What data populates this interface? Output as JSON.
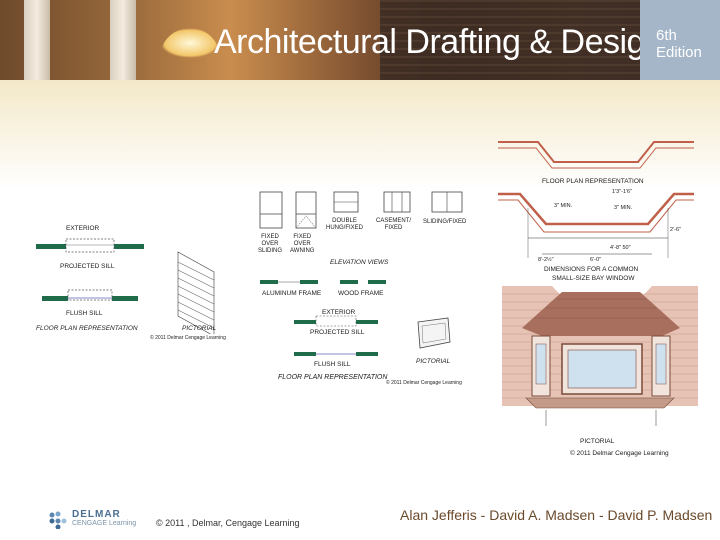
{
  "header": {
    "title": "Architectural Drafting & Design",
    "edition_line1": "6th",
    "edition_line2": "Edition"
  },
  "left_figure": {
    "exterior": "EXTERIOR",
    "projected_sill": "PROJECTED SILL",
    "flush_sill": "FLUSH SILL",
    "floor_plan": "FLOOR PLAN REPRESENTATION",
    "pictorial": "PICTORIAL",
    "copyright": "© 2011 Delmar Cengage Learning"
  },
  "middle_figure": {
    "windows": [
      {
        "label": "FIXED\nOVER\nSLIDING"
      },
      {
        "label": "FIXED\nOVER\nAWNING"
      },
      {
        "label": "DOUBLE\nHUNG/FIXED"
      },
      {
        "label": "CASEMENT/\nFIXED"
      },
      {
        "label": "SLIDING/FIXED"
      }
    ],
    "elevation_views": "ELEVATION VIEWS",
    "aluminum_frame": "ALUMINUM FRAME",
    "wood_frame": "WOOD FRAME",
    "exterior": "EXTERIOR",
    "projected_sill": "PROJECTED SILL",
    "flush_sill": "FLUSH SILL",
    "pictorial": "PICTORIAL",
    "floor_plan": "FLOOR PLAN REPRESENTATION",
    "copyright": "© 2011 Delmar Cengage Learning"
  },
  "right_figure": {
    "floor_plan": "FLOOR PLAN REPRESENTATION",
    "dim_a": "1'3\"-1'6\"",
    "dim_b": "3\" MIN.",
    "dim_c": "3\" MIN.",
    "dim_d": "2'-6\"",
    "dim_e": "4'-8\" 50\"",
    "dim_f": "8'-2½\"",
    "dim_g": "6'-0\"",
    "caption1": "DIMENSIONS FOR A COMMON",
    "caption2": "SMALL-SIZE BAY WINDOW",
    "pictorial": "PICTORIAL",
    "copyright": "© 2011 Delmar Cengage Learning"
  },
  "footer": {
    "logo_top": "DELMAR",
    "logo_bottom": "CENGAGE Learning",
    "copyright": "© 2011 , Delmar, Cengage Learning",
    "authors": "Alan Jefferis - David A. Madsen - David P. Madsen"
  },
  "colors": {
    "edition_bg": "#a5b6c9",
    "sill_green": "#1f6b4a",
    "roof_brown": "#a86f5e",
    "wall_pink": "#e6c3b4"
  }
}
